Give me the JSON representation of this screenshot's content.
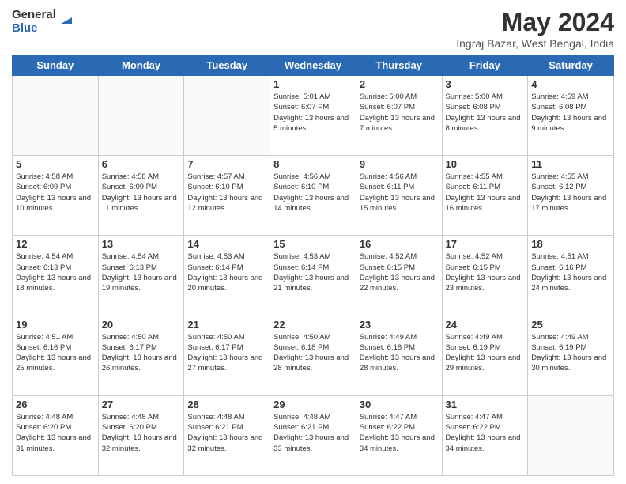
{
  "header": {
    "logo_general": "General",
    "logo_blue": "Blue",
    "title": "May 2024",
    "subtitle": "Ingraj Bazar, West Bengal, India"
  },
  "weekdays": [
    "Sunday",
    "Monday",
    "Tuesday",
    "Wednesday",
    "Thursday",
    "Friday",
    "Saturday"
  ],
  "weeks": [
    [
      {
        "day": "",
        "info": ""
      },
      {
        "day": "",
        "info": ""
      },
      {
        "day": "",
        "info": ""
      },
      {
        "day": "1",
        "info": "Sunrise: 5:01 AM\nSunset: 6:07 PM\nDaylight: 13 hours and 5 minutes."
      },
      {
        "day": "2",
        "info": "Sunrise: 5:00 AM\nSunset: 6:07 PM\nDaylight: 13 hours and 7 minutes."
      },
      {
        "day": "3",
        "info": "Sunrise: 5:00 AM\nSunset: 6:08 PM\nDaylight: 13 hours and 8 minutes."
      },
      {
        "day": "4",
        "info": "Sunrise: 4:59 AM\nSunset: 6:08 PM\nDaylight: 13 hours and 9 minutes."
      }
    ],
    [
      {
        "day": "5",
        "info": "Sunrise: 4:58 AM\nSunset: 6:09 PM\nDaylight: 13 hours and 10 minutes."
      },
      {
        "day": "6",
        "info": "Sunrise: 4:58 AM\nSunset: 6:09 PM\nDaylight: 13 hours and 11 minutes."
      },
      {
        "day": "7",
        "info": "Sunrise: 4:57 AM\nSunset: 6:10 PM\nDaylight: 13 hours and 12 minutes."
      },
      {
        "day": "8",
        "info": "Sunrise: 4:56 AM\nSunset: 6:10 PM\nDaylight: 13 hours and 14 minutes."
      },
      {
        "day": "9",
        "info": "Sunrise: 4:56 AM\nSunset: 6:11 PM\nDaylight: 13 hours and 15 minutes."
      },
      {
        "day": "10",
        "info": "Sunrise: 4:55 AM\nSunset: 6:11 PM\nDaylight: 13 hours and 16 minutes."
      },
      {
        "day": "11",
        "info": "Sunrise: 4:55 AM\nSunset: 6:12 PM\nDaylight: 13 hours and 17 minutes."
      }
    ],
    [
      {
        "day": "12",
        "info": "Sunrise: 4:54 AM\nSunset: 6:13 PM\nDaylight: 13 hours and 18 minutes."
      },
      {
        "day": "13",
        "info": "Sunrise: 4:54 AM\nSunset: 6:13 PM\nDaylight: 13 hours and 19 minutes."
      },
      {
        "day": "14",
        "info": "Sunrise: 4:53 AM\nSunset: 6:14 PM\nDaylight: 13 hours and 20 minutes."
      },
      {
        "day": "15",
        "info": "Sunrise: 4:53 AM\nSunset: 6:14 PM\nDaylight: 13 hours and 21 minutes."
      },
      {
        "day": "16",
        "info": "Sunrise: 4:52 AM\nSunset: 6:15 PM\nDaylight: 13 hours and 22 minutes."
      },
      {
        "day": "17",
        "info": "Sunrise: 4:52 AM\nSunset: 6:15 PM\nDaylight: 13 hours and 23 minutes."
      },
      {
        "day": "18",
        "info": "Sunrise: 4:51 AM\nSunset: 6:16 PM\nDaylight: 13 hours and 24 minutes."
      }
    ],
    [
      {
        "day": "19",
        "info": "Sunrise: 4:51 AM\nSunset: 6:16 PM\nDaylight: 13 hours and 25 minutes."
      },
      {
        "day": "20",
        "info": "Sunrise: 4:50 AM\nSunset: 6:17 PM\nDaylight: 13 hours and 26 minutes."
      },
      {
        "day": "21",
        "info": "Sunrise: 4:50 AM\nSunset: 6:17 PM\nDaylight: 13 hours and 27 minutes."
      },
      {
        "day": "22",
        "info": "Sunrise: 4:50 AM\nSunset: 6:18 PM\nDaylight: 13 hours and 28 minutes."
      },
      {
        "day": "23",
        "info": "Sunrise: 4:49 AM\nSunset: 6:18 PM\nDaylight: 13 hours and 28 minutes."
      },
      {
        "day": "24",
        "info": "Sunrise: 4:49 AM\nSunset: 6:19 PM\nDaylight: 13 hours and 29 minutes."
      },
      {
        "day": "25",
        "info": "Sunrise: 4:49 AM\nSunset: 6:19 PM\nDaylight: 13 hours and 30 minutes."
      }
    ],
    [
      {
        "day": "26",
        "info": "Sunrise: 4:48 AM\nSunset: 6:20 PM\nDaylight: 13 hours and 31 minutes."
      },
      {
        "day": "27",
        "info": "Sunrise: 4:48 AM\nSunset: 6:20 PM\nDaylight: 13 hours and 32 minutes."
      },
      {
        "day": "28",
        "info": "Sunrise: 4:48 AM\nSunset: 6:21 PM\nDaylight: 13 hours and 32 minutes."
      },
      {
        "day": "29",
        "info": "Sunrise: 4:48 AM\nSunset: 6:21 PM\nDaylight: 13 hours and 33 minutes."
      },
      {
        "day": "30",
        "info": "Sunrise: 4:47 AM\nSunset: 6:22 PM\nDaylight: 13 hours and 34 minutes."
      },
      {
        "day": "31",
        "info": "Sunrise: 4:47 AM\nSunset: 6:22 PM\nDaylight: 13 hours and 34 minutes."
      },
      {
        "day": "",
        "info": ""
      }
    ]
  ]
}
